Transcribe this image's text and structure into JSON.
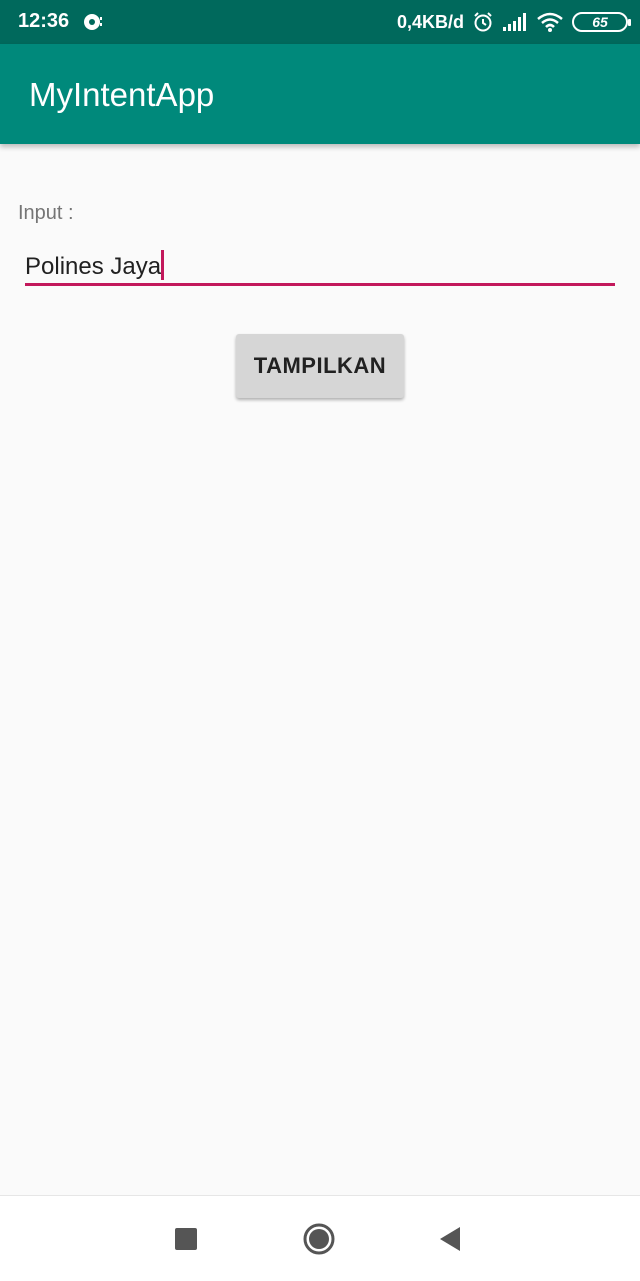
{
  "status_bar": {
    "time": "12:36",
    "network_speed": "0,4KB/d",
    "battery_level": "65",
    "icons": [
      "notification-icon",
      "alarm-icon",
      "signal-icon",
      "wifi-icon",
      "battery-icon"
    ]
  },
  "app_bar": {
    "title": "MyIntentApp"
  },
  "form": {
    "label": "Input :",
    "input_value": "Polines Jaya",
    "accent_color": "#c2185b"
  },
  "button": {
    "label": "TAMPILKAN"
  },
  "nav_bar": {
    "icons": [
      "recents-icon",
      "home-icon",
      "back-icon"
    ]
  },
  "colors": {
    "primary": "#00897b",
    "primary_dark": "#00695c",
    "accent": "#c2185b"
  }
}
